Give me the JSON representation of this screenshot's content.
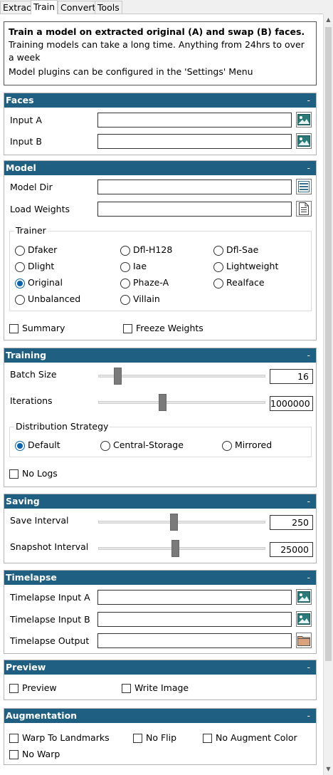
{
  "tabs": [
    "Extract",
    "Train",
    "Convert",
    "Tools"
  ],
  "info": {
    "heading": "Train a model on extracted original (A) and swap (B) faces.",
    "line1": "Training models can take a long time. Anything from 24hrs to over a week",
    "line2": "Model plugins can be configured in the 'Settings' Menu"
  },
  "faces": {
    "title": "Faces",
    "collapse": "-",
    "input_a": "Input A",
    "input_b": "Input B"
  },
  "model": {
    "title": "Model",
    "collapse": "-",
    "model_dir": "Model Dir",
    "load_weights": "Load Weights",
    "trainer_title": "Trainer",
    "trainers": [
      "Dfaker",
      "Dfl-H128",
      "Dfl-Sae",
      "Dlight",
      "Iae",
      "Lightweight",
      "Original",
      "Phaze-A",
      "Realface",
      "Unbalanced",
      "Villain"
    ],
    "selected_trainer": "Original",
    "summary": "Summary",
    "freeze_weights": "Freeze Weights"
  },
  "training": {
    "title": "Training",
    "collapse": "-",
    "batch_size_label": "Batch Size",
    "batch_size": "16",
    "batch_slider": 0.1,
    "iterations_label": "Iterations",
    "iterations": "1000000",
    "iter_slider": 0.38,
    "dist_title": "Distribution Strategy",
    "strategies": [
      "Default",
      "Central-Storage",
      "Mirrored"
    ],
    "selected_strategy": "Default",
    "no_logs": "No Logs"
  },
  "saving": {
    "title": "Saving",
    "collapse": "-",
    "save_interval_label": "Save Interval",
    "save_interval": "250",
    "save_slider": 0.45,
    "snapshot_interval_label": "Snapshot Interval",
    "snapshot_interval": "25000",
    "snap_slider": 0.46
  },
  "timelapse": {
    "title": "Timelapse",
    "collapse": "-",
    "input_a": "Timelapse Input A",
    "input_b": "Timelapse Input B",
    "output": "Timelapse Output"
  },
  "preview": {
    "title": "Preview",
    "collapse": "-",
    "preview": "Preview",
    "write_image": "Write Image"
  },
  "augmentation": {
    "title": "Augmentation",
    "collapse": "-",
    "warp_to_landmarks": "Warp To Landmarks",
    "no_flip": "No Flip",
    "no_augment_color": "No Augment Color",
    "no_warp": "No Warp"
  },
  "colors": {
    "header": "#1f6082",
    "radio_selected": "#0a64ad"
  },
  "icons": [
    "image-icon",
    "folder-icon",
    "file-icon",
    "list-icon"
  ]
}
